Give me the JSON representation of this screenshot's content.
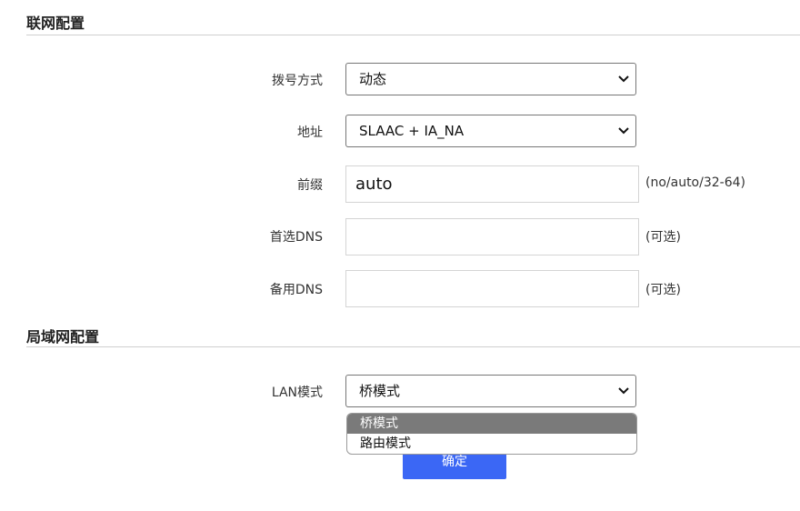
{
  "wan": {
    "title": "联网配置",
    "dial_mode": {
      "label": "拨号方式",
      "value": "动态"
    },
    "address": {
      "label": "地址",
      "value": "SLAAC + IA_NA"
    },
    "prefix": {
      "label": "前缀",
      "value": "auto",
      "hint": "(no/auto/32-64)"
    },
    "primary_dns": {
      "label": "首选DNS",
      "value": "",
      "hint": "(可选)"
    },
    "backup_dns": {
      "label": "备用DNS",
      "value": "",
      "hint": "(可选)"
    }
  },
  "lan": {
    "title": "局域网配置",
    "mode": {
      "label": "LAN模式",
      "value": "桥模式",
      "options": [
        "桥模式",
        "路由模式"
      ]
    }
  },
  "confirm_label": "确定",
  "icons": {
    "select_arrow": "chevron-down-icon"
  },
  "colors": {
    "primary_button": "#3b67f5",
    "option_highlight": "#7a7a7a"
  }
}
